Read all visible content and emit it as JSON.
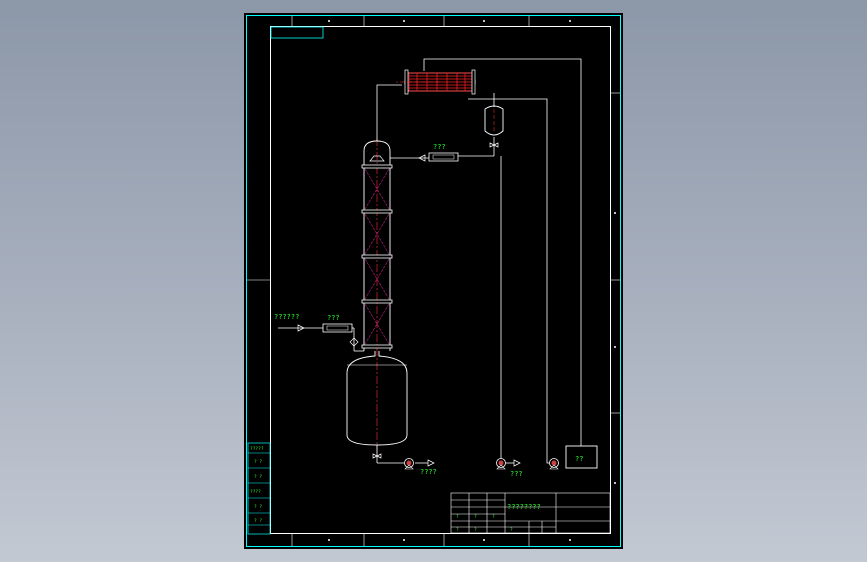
{
  "colors": {
    "frame": "#00ffff",
    "line": "#ffffff",
    "center_line": "#ff3030",
    "packing": "#c02080",
    "exchanger": "#ff2020",
    "text": "#2aff2a"
  },
  "labels": {
    "feed_label": "??????",
    "feed_heater_label": "???",
    "reflux_heater_label": "???",
    "bottom_product_label": "????",
    "distillate_pump_label": "???",
    "tank_label": "??",
    "title_block_name": "????????"
  },
  "side_table": {
    "rows": [
      "?????",
      "? ?",
      "? ?",
      "????",
      "? ?",
      "? ?"
    ]
  },
  "title_block": {
    "left_cells": [
      "?",
      "?",
      "?",
      "?",
      "?",
      "?"
    ]
  },
  "icons": {
    "pumps": [
      "pump-icon",
      "pump-icon",
      "pump-icon"
    ],
    "valves": [
      "valve-icon",
      "valve-icon",
      "valve-icon"
    ]
  }
}
